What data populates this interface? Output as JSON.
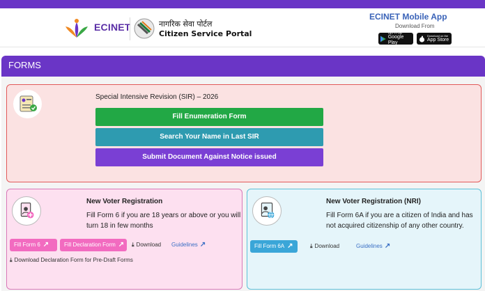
{
  "header": {
    "brand_name": "ECINET",
    "portal_hindi": "नागरिक सेवा पोर्टल",
    "portal_english": "Citizen Service Portal",
    "app_title": "ECINET Mobile App",
    "app_subtitle": "Download From",
    "google_play_small": "GET IT ON",
    "google_play_label": "Google Play",
    "app_store_small": "Download on the",
    "app_store_label": "App Store",
    "brand_color": "#6a35c6"
  },
  "forms": {
    "title": "FORMS"
  },
  "sir": {
    "title": "Special Intensive Revision (SIR) – 2026",
    "buttons": [
      {
        "label": "Fill Enumeration Form",
        "color": "#22a845"
      },
      {
        "label": "Search Your Name in Last SIR",
        "color": "#2e9bb0"
      },
      {
        "label": "Submit Document Against Notice issued",
        "color": "#7a3fd4"
      }
    ]
  },
  "new_voter": {
    "title": "New Voter Registration",
    "description": "Fill Form 6 if you are 18 years or above or you will turn 18 in few months",
    "fill_form_label": "Fill Form 6",
    "fill_declaration_label": "Fill Declaration Form",
    "download_label": "Download",
    "guidelines_label": "Guidelines",
    "download_declaration_label": "Download Declaration Form for Pre-Draft Forms"
  },
  "nri_voter": {
    "title": "New Voter Registration (NRI)",
    "description": "Fill Form 6A if you are a citizen of India and has not acquired citizenship of any other country.",
    "fill_form_label": "Fill Form 6A",
    "download_label": "Download",
    "guidelines_label": "Guidelines"
  }
}
